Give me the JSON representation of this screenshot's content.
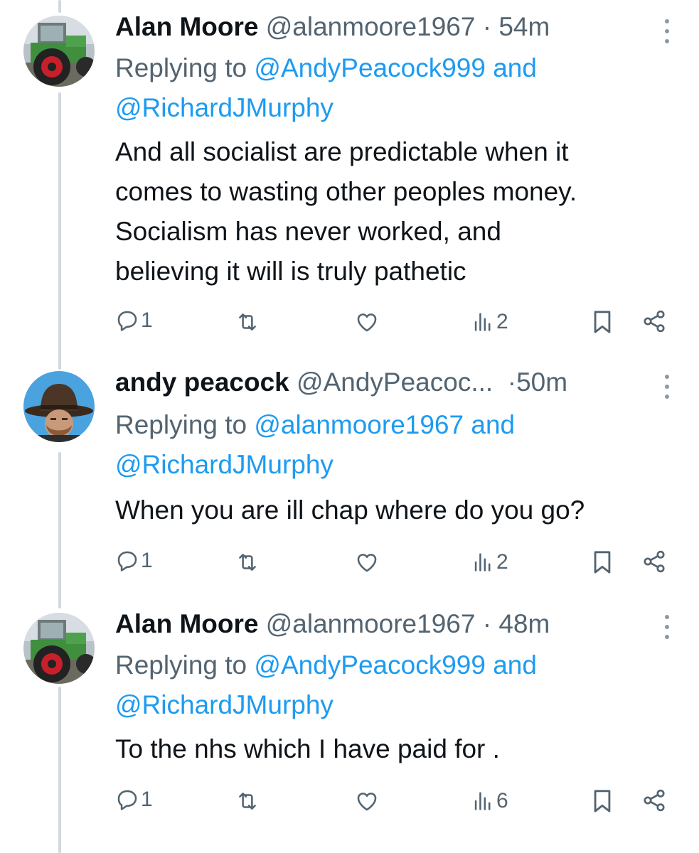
{
  "tweets": [
    {
      "name": "Alan Moore",
      "handle": "@alanmoore1967",
      "separator": "·",
      "time": "54m",
      "replying_prefix": "Replying to ",
      "replying_mention_1": "@AndyPeacock999",
      "replying_and": " and",
      "replying_mention_2": "@RichardJMurphy",
      "body_lines": [
        "And all socialist are predictable when it",
        "comes to wasting other peoples money.",
        "Socialism has never worked, and",
        "believing it will is truly pathetic"
      ],
      "reply_count": "1",
      "views": "2",
      "avatar": "tractor-avatar"
    },
    {
      "name": "andy peacock",
      "handle": "@AndyPeacoc...",
      "separator": "·",
      "time": "50m",
      "replying_prefix": "Replying to ",
      "replying_mention_1": "@alanmoore1967",
      "replying_and": " and",
      "replying_mention_2": "@RichardJMurphy",
      "body_lines": [
        "When you are ill chap where do you go?"
      ],
      "reply_count": "1",
      "views": "2",
      "avatar": "man-in-hat-avatar"
    },
    {
      "name": "Alan Moore",
      "handle": "@alanmoore1967",
      "separator": "·",
      "time": "48m",
      "replying_prefix": "Replying to ",
      "replying_mention_1": "@AndyPeacock999",
      "replying_and": " and",
      "replying_mention_2": "@RichardJMurphy",
      "body_lines": [
        "To the nhs which I have paid for ."
      ],
      "reply_count": "1",
      "views": "6",
      "avatar": "tractor-avatar"
    }
  ],
  "icons": [
    "reply-icon",
    "retweet-icon",
    "like-icon",
    "views-icon",
    "bookmark-icon",
    "share-icon",
    "more-icon"
  ],
  "colors": {
    "link": "#1d9bf0",
    "secondary_text": "#536471",
    "primary_text": "#0f1419",
    "thread_line": "#cfd9de"
  }
}
